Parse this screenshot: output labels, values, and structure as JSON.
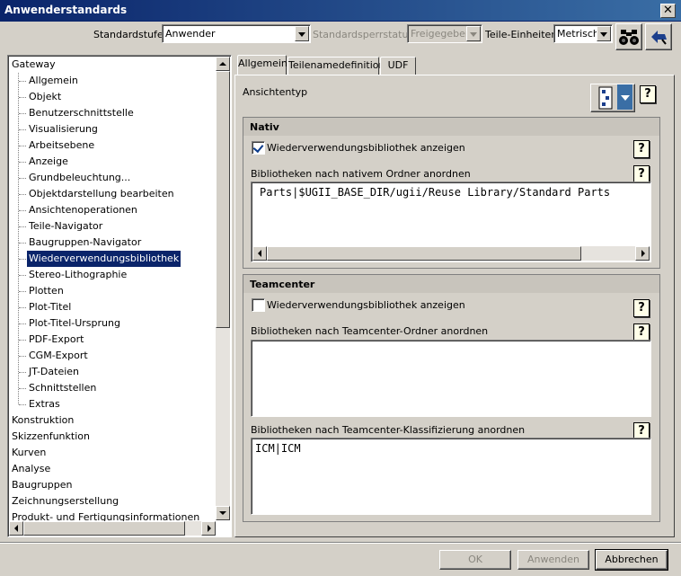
{
  "window": {
    "title": "Anwenderstandards",
    "close_label": "✕"
  },
  "toolbar": {
    "standardstufe_label": "Standardstufe",
    "standardstufe_value": "Anwender",
    "sperrstatus_label": "Standardsperrstatus",
    "sperrstatus_value": "Freigegeben",
    "einheiten_label": "Teile-Einheiten",
    "einheiten_value": "Metrisch",
    "find_icon": "binoculars-icon",
    "back_icon": "reset-arrow-icon"
  },
  "tree": {
    "gateway": "Gateway",
    "gateway_children": [
      "Allgemein",
      "Objekt",
      "Benutzerschnittstelle",
      "Visualisierung",
      "Arbeitsebene",
      "Anzeige",
      "Grundbeleuchtung...",
      "Objektdarstellung bearbeiten",
      "Ansichtenoperationen",
      "Teile-Navigator",
      "Baugruppen-Navigator",
      "Wiederverwendungsbibliothek",
      "Stereo-Lithographie",
      "Plotten",
      "Plot-Titel",
      "Plot-Titel-Ursprung",
      "PDF-Export",
      "CGM-Export",
      "JT-Dateien",
      "Schnittstellen",
      "Extras"
    ],
    "selected": "Wiederverwendungsbibliothek",
    "top_level": [
      "Konstruktion",
      "Skizzenfunktion",
      "Kurven",
      "Analyse",
      "Baugruppen",
      "Zeichnungserstellung",
      "Produkt- und Fertigungsinformationen"
    ]
  },
  "tabs": [
    "Allgemein",
    "Teilenamedefinition",
    "UDF"
  ],
  "panel": {
    "ansichtentyp_label": "Ansichtentyp",
    "help_label": "?",
    "nativ": {
      "title": "Nativ",
      "checkbox_label": "Wiederverwendungsbibliothek anzeigen",
      "checked": true,
      "order_label": "Bibliotheken nach nativem Ordner anordnen",
      "order_value": "Parts|$UGII_BASE_DIR/ugii/Reuse Library/Standard Parts"
    },
    "teamcenter": {
      "title": "Teamcenter",
      "checkbox_label": "Wiederverwendungsbibliothek anzeigen",
      "checked": false,
      "order_label": "Bibliotheken nach Teamcenter-Ordner anordnen",
      "order_value": "",
      "class_label": "Bibliotheken nach Teamcenter-Klassifizierung anordnen",
      "class_value": "ICM|ICM"
    }
  },
  "buttons": {
    "ok": "OK",
    "apply": "Anwenden",
    "cancel": "Abbrechen"
  }
}
